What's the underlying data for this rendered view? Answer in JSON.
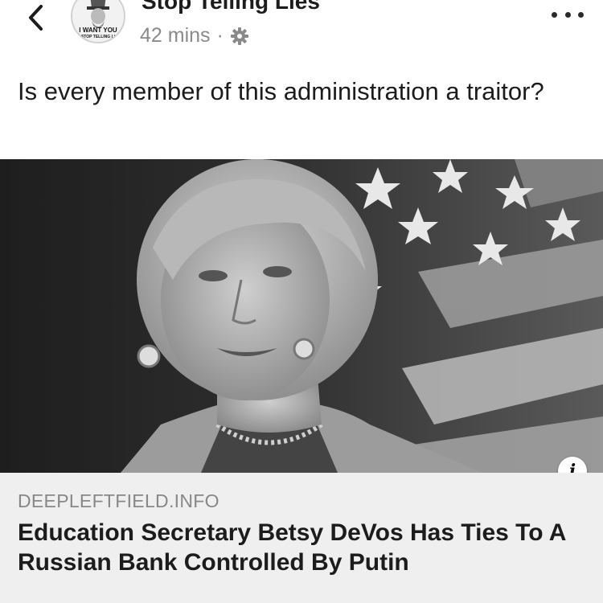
{
  "header": {
    "back_icon": "chevron-left-icon",
    "page_name": "Stop Telling Lies",
    "avatar_text": [
      "I WANT YOU",
      "STOP TELLING LI"
    ],
    "timestamp": "42 mins",
    "separator": "·",
    "privacy_icon": "gear-icon",
    "more_icon": "more-dots-icon"
  },
  "post": {
    "text": "Is every member of this administration a traitor?"
  },
  "link_preview": {
    "image_icon": "info-icon",
    "info_label": "i",
    "domain": "DEEPLEFTFIELD.INFO",
    "headline": "Education Secretary Betsy DeVos Has Ties To A Russian Bank Controlled By Putin"
  },
  "colors": {
    "background": "#ffffff",
    "text": "#1c1c1c",
    "meta": "#8a8a8a",
    "card_bg": "#efefef"
  }
}
